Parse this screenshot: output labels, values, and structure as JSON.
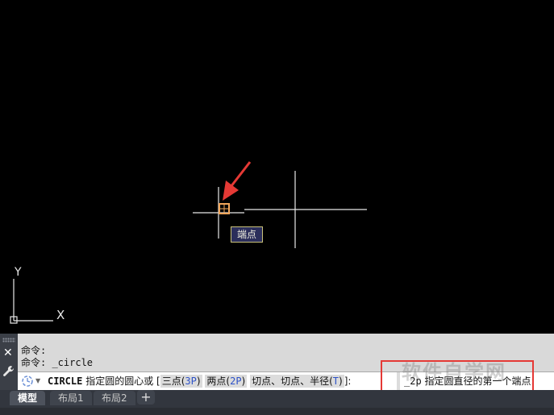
{
  "drawing": {
    "ucs_y_label": "Y",
    "ucs_x_label": "X",
    "osnap_tooltip": "端点"
  },
  "command_panel": {
    "history": [
      "命令:",
      "命令: _circle"
    ],
    "input": {
      "command": "CIRCLE",
      "prompt": "指定圆的圆心或",
      "bracket_open": "[",
      "options": [
        {
          "label": "三点",
          "key": "3P"
        },
        {
          "label": "两点",
          "key": "2P"
        },
        {
          "label": "切点、切点、半径",
          "key": "T"
        }
      ],
      "bracket_close": "]:",
      "entered_value": "_2p",
      "next_prompt": "指定圆直径的第一个端点:"
    }
  },
  "watermark": "软件自学网",
  "tabs": [
    {
      "label": "模型",
      "active": true
    },
    {
      "label": "布局1",
      "active": false
    },
    {
      "label": "布局2",
      "active": false
    }
  ],
  "add_tab_label": "+",
  "colors": {
    "background": "#000000",
    "crosshair": "#e8e8e8",
    "osnap_marker": "#f2a65a",
    "arrow": "#e53935",
    "highlight": "#e53935",
    "option_key": "#2d52c8"
  }
}
